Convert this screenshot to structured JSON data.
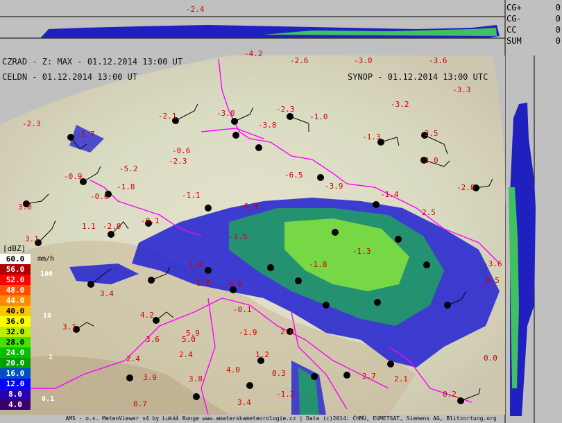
{
  "header": {
    "line1": "CZRAD - Z: MAX - 01.12.2014 13:00 UT",
    "line2": "CELDN - 01.12.2014 13:00 UT",
    "synop": "SYNOP - 01.12.2014 13:00 UTC"
  },
  "lightning_counts": [
    {
      "label": "CG+",
      "value": "0"
    },
    {
      "label": "CG-",
      "value": "0"
    },
    {
      "label": "CC",
      "value": "0"
    },
    {
      "label": "SUM",
      "value": "0"
    }
  ],
  "legend": {
    "unit_title": "[dBZ]",
    "rate_unit": "mm/h",
    "dbz_levels": [
      {
        "label": "60.0",
        "color": "#ffffff"
      },
      {
        "label": "56.0",
        "color": "#b00000"
      },
      {
        "label": "52.0",
        "color": "#ff0000"
      },
      {
        "label": "48.0",
        "color": "#ff5000"
      },
      {
        "label": "44.0",
        "color": "#ff8c00"
      },
      {
        "label": "40.0",
        "color": "#ffc400"
      },
      {
        "label": "36.0",
        "color": "#ffff00"
      },
      {
        "label": "32.0",
        "color": "#b8f000"
      },
      {
        "label": "28.0",
        "color": "#48e000"
      },
      {
        "label": "24.0",
        "color": "#00c000"
      },
      {
        "label": "20.0",
        "color": "#00a000"
      },
      {
        "label": "16.0",
        "color": "#0050c0"
      },
      {
        "label": "12.0",
        "color": "#0000ff"
      },
      {
        "label": "8.0",
        "color": "#2800b0"
      },
      {
        "label": "4.0",
        "color": "#380070"
      }
    ],
    "rain_rates": [
      "100",
      "10",
      "1",
      "0.1"
    ]
  },
  "synop_temps": [
    "-4.2",
    "-2.4",
    "-2.6",
    "-3.0",
    "-3.6",
    "-3.3",
    "-2.3",
    "-1.7",
    "-2.1",
    "-3.0",
    "-2.3",
    "-1.0",
    "-3.2",
    "-3.8",
    "-3.5",
    "-2.6",
    "-1.3",
    "-3.0",
    "-0.6",
    "-2.3",
    "-5.2",
    "-1.8",
    "-6.5",
    "-2.0",
    "-0.9",
    "-0.6",
    "-1.8",
    "-3.9",
    "-1.4",
    "-1.1",
    "3.8",
    "3.1",
    "1.1",
    "-2.0",
    "-0.1",
    "-1.5",
    "-0.4",
    "-1.3",
    "-1.8",
    "1.0",
    "1.6",
    "-0.8",
    "3.4",
    "-0.1",
    "4.2",
    "3.1",
    "3.6",
    "5.0",
    "5.9",
    "2.4",
    "-1.9",
    "2.6",
    "1.2",
    "2.4",
    "4.0",
    "3.9",
    "3.8",
    "0.3",
    "-1.2",
    "3.4",
    "0.7",
    "0.2",
    "0.0",
    "2.1",
    "2.7",
    "-3.6",
    "0.5",
    "2.5"
  ],
  "footer": "AMS - o.s. MeteoViewer v4 by Lukáš Ronge www.amaterskameteorologie.cz | Data (c)2014: ČHMÚ, EUMETSAT, Siemens AG, Blitzortung.org"
}
